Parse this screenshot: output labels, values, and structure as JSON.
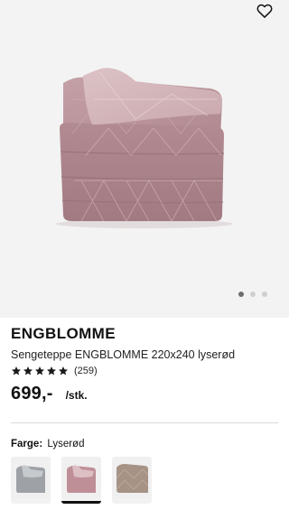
{
  "gallery": {
    "image_alt": "Sengeteppe ENGBLOMME lyserød",
    "favorite_icon": "heart-outline-icon",
    "image_count": 3,
    "current_image": 1
  },
  "product": {
    "brand": "ENGBLOMME",
    "title": "Sengeteppe ENGBLOMME 220x240 lyserød",
    "rating": 5,
    "review_count": "(259)",
    "price": "699,-",
    "unit": "/stk."
  },
  "variants": {
    "label": "Farge:",
    "selected_color": "Lyserød",
    "options": [
      {
        "color": "#a4a8ad",
        "selected": false
      },
      {
        "color": "#c89aa1",
        "selected": true
      },
      {
        "color": "#a8978a",
        "selected": false
      }
    ]
  },
  "colors": {
    "accent": "#111111",
    "star": "#1a1a1a",
    "gallery_background": "#f3f3f3"
  }
}
